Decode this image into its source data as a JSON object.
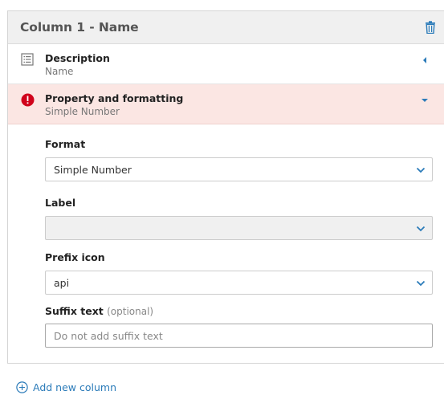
{
  "header": {
    "title": "Column 1 - Name",
    "delete_icon": "trash-icon"
  },
  "sections": {
    "description": {
      "title": "Description",
      "subtitle": "Name",
      "icon": "list-icon",
      "chevron": "chevron-left-icon"
    },
    "property": {
      "title": "Property and formatting",
      "subtitle": "Simple Number",
      "icon": "error-icon",
      "chevron": "chevron-down-icon",
      "error_color": "#d0021b"
    }
  },
  "form": {
    "format": {
      "label": "Format",
      "value": "Simple Number"
    },
    "label": {
      "label": "Label",
      "value": ""
    },
    "prefix_icon": {
      "label": "Prefix icon",
      "value": "api"
    },
    "suffix_text": {
      "label": "Suffix text",
      "optional": "(optional)",
      "placeholder": "Do not add suffix text"
    }
  },
  "footer": {
    "add_column_label": "Add new column"
  },
  "colors": {
    "accent": "#2b7bb9",
    "error_row_bg": "#fbe6e3"
  }
}
